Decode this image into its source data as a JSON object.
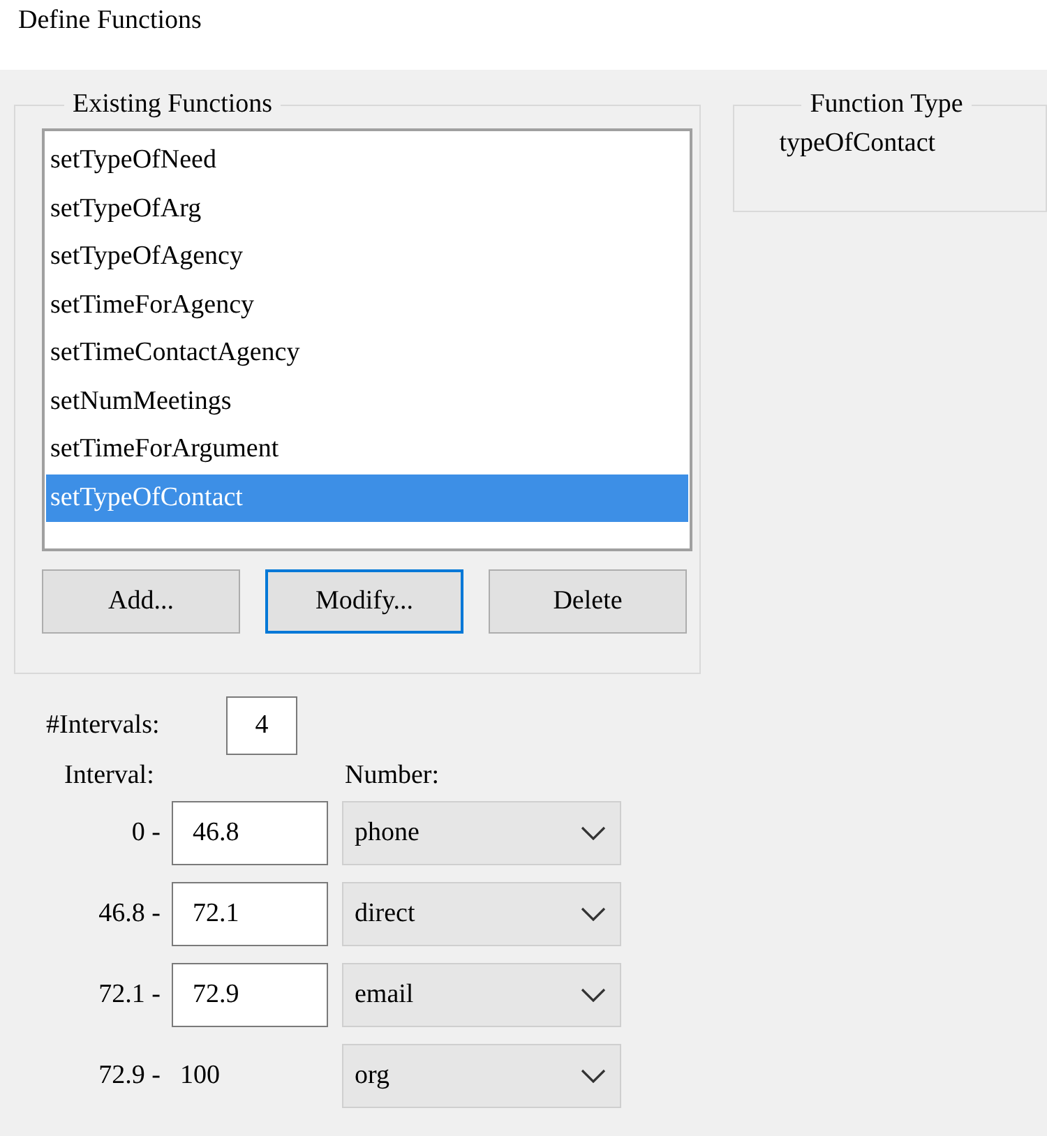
{
  "window": {
    "title": "Define Functions"
  },
  "existing_functions": {
    "title": "Existing Functions",
    "items": [
      {
        "label": "setTypeOfNeed",
        "selected": false
      },
      {
        "label": "setTypeOfArg",
        "selected": false
      },
      {
        "label": "setTypeOfAgency",
        "selected": false
      },
      {
        "label": "setTimeForAgency",
        "selected": false
      },
      {
        "label": "setTimeContactAgency",
        "selected": false
      },
      {
        "label": "setNumMeetings",
        "selected": false
      },
      {
        "label": "setTimeForArgument",
        "selected": false
      },
      {
        "label": "setTypeOfContact",
        "selected": true
      }
    ],
    "buttons": [
      {
        "label": "Add...",
        "focused": false
      },
      {
        "label": "Modify...",
        "focused": true
      },
      {
        "label": "Delete",
        "focused": false
      }
    ]
  },
  "function_type": {
    "title": "Function Type",
    "value": "typeOfContact"
  },
  "intervals": {
    "label": "#Intervals:",
    "value": "4"
  },
  "columns": [
    "Interval:",
    "Number:"
  ],
  "rows": [
    {
      "start": "0 -",
      "end": "46.8",
      "kind": "field",
      "number": "phone"
    },
    {
      "start": "46.8 -",
      "end": "72.1",
      "kind": "field",
      "number": "direct"
    },
    {
      "start": "72.1 -",
      "end": "72.9",
      "kind": "field",
      "number": "email"
    },
    {
      "start": "72.9 -",
      "end": "100",
      "kind": "text",
      "number": "org"
    }
  ]
}
